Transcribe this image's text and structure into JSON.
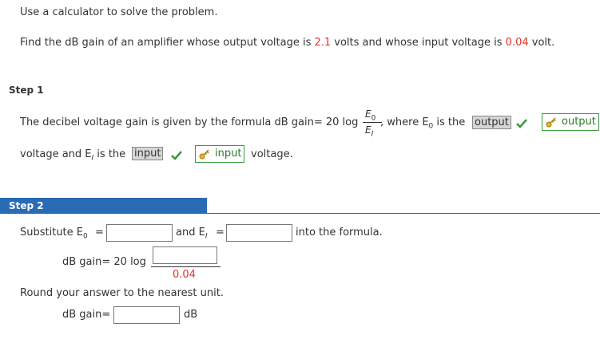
{
  "instruction": "Use a calculator to solve the problem.",
  "problem": {
    "part1": "Find the dB gain of an amplifier whose output voltage is ",
    "output_value": "2.1",
    "part2": " volts and whose input voltage is ",
    "input_value": "0.04",
    "part3": " volt."
  },
  "step1": {
    "label": "Step 1",
    "line1_text": "The decibel voltage gain is given by the formula dB gain= 20 log",
    "frac_num": "E",
    "frac_num_sub": "0",
    "frac_den": "E",
    "frac_den_sub": "I",
    "where_text": ", where E",
    "where_sub": "0",
    "is_the": " is the",
    "filled_output": "output",
    "answer_output": "output",
    "line2_text": "voltage and E",
    "line2_sub": "I",
    "line2_is_the": " is the",
    "filled_input": "input",
    "answer_input": "input",
    "voltage_suffix": "voltage."
  },
  "step2": {
    "label": "Step 2",
    "substitute": "Substitute E",
    "substitute_sub": "0",
    "equals": "=",
    "and_text": "and E",
    "and_sub": "I",
    "equals2": "=",
    "into_formula": "into the formula.",
    "db_gain_log": "dB gain= 20 log",
    "denominator": "0.04",
    "round_text": "Round your answer to the nearest unit.",
    "db_gain_label": "dB gain=",
    "unit": "dB"
  },
  "colors": {
    "accent": "#2a6bb5",
    "highlight": "#e8322b",
    "correct": "#3a9a3a"
  }
}
